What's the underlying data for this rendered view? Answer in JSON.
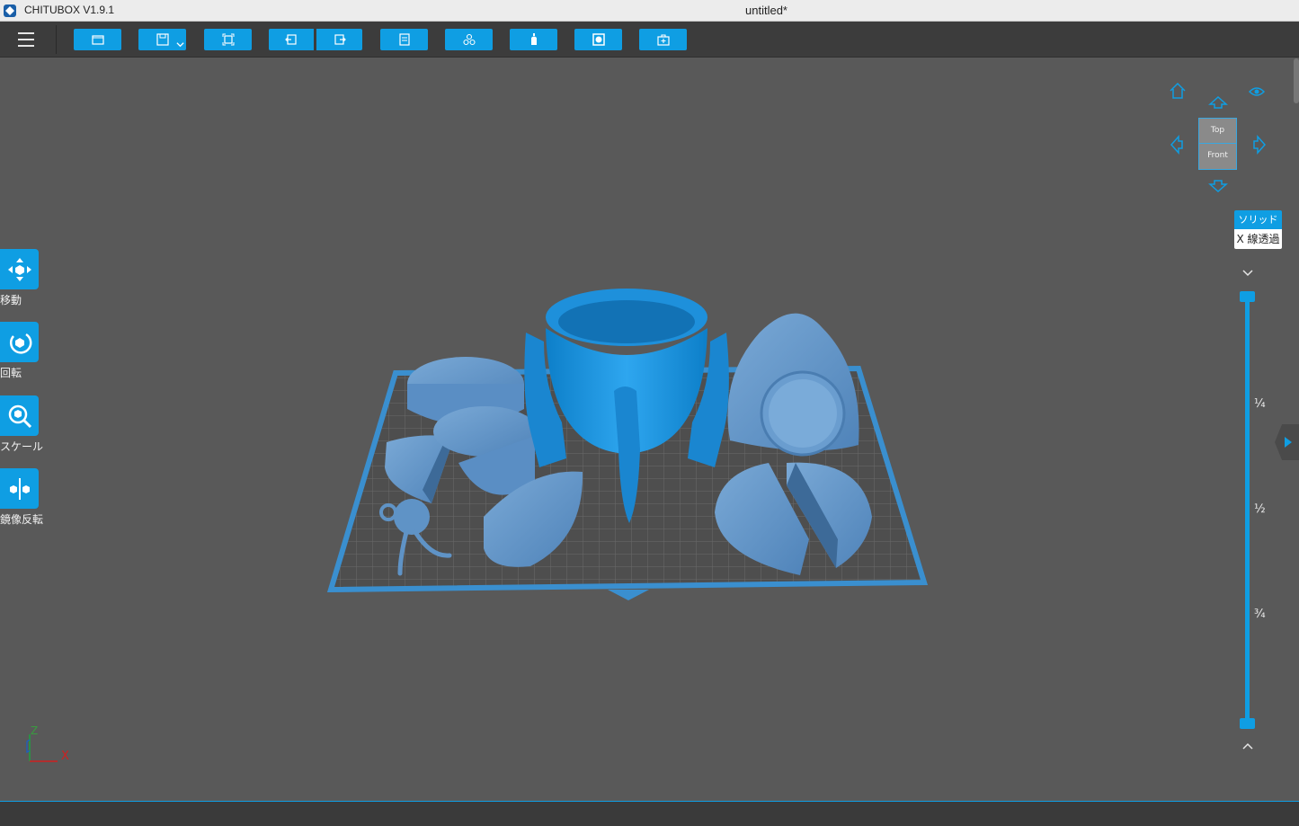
{
  "titlebar": {
    "app_name": "CHITUBOX V1.9.1",
    "document_title": "untitled*"
  },
  "toolbar": {
    "buttons": [
      {
        "name": "open-file",
        "icon": "folder-icon"
      },
      {
        "name": "save",
        "icon": "save-icon"
      },
      {
        "name": "screenshot",
        "icon": "screenshot-icon"
      },
      {
        "name": "undo",
        "icon": "undo-icon"
      },
      {
        "name": "redo",
        "icon": "redo-icon"
      },
      {
        "name": "settings",
        "icon": "list-icon"
      },
      {
        "name": "arrange",
        "icon": "arrange-icon"
      },
      {
        "name": "support",
        "icon": "bottle-icon"
      },
      {
        "name": "hollow",
        "icon": "hollow-icon"
      },
      {
        "name": "slice",
        "icon": "slice-icon"
      }
    ]
  },
  "left_tools": [
    {
      "label": "移動",
      "icon": "move-icon"
    },
    {
      "label": "回転",
      "icon": "rotate-icon"
    },
    {
      "label": "スケール",
      "icon": "scale-icon"
    },
    {
      "label": "鏡像反転",
      "icon": "mirror-icon"
    }
  ],
  "navcube": {
    "top_label": "Top",
    "front_label": "Front"
  },
  "render_mode": {
    "solid_label": "ソリッド",
    "xray_label": "X 線透過"
  },
  "layer_slider": {
    "tick_quarter": "¼",
    "tick_half": "½",
    "tick_three_quarter": "¾"
  },
  "axis": {
    "z_label": "Z",
    "x_label": "X"
  },
  "colors": {
    "accent": "#0f9ee3",
    "viewport": "#595959",
    "model": "#5a8ec4",
    "model_selected": "#1d8fd8"
  }
}
